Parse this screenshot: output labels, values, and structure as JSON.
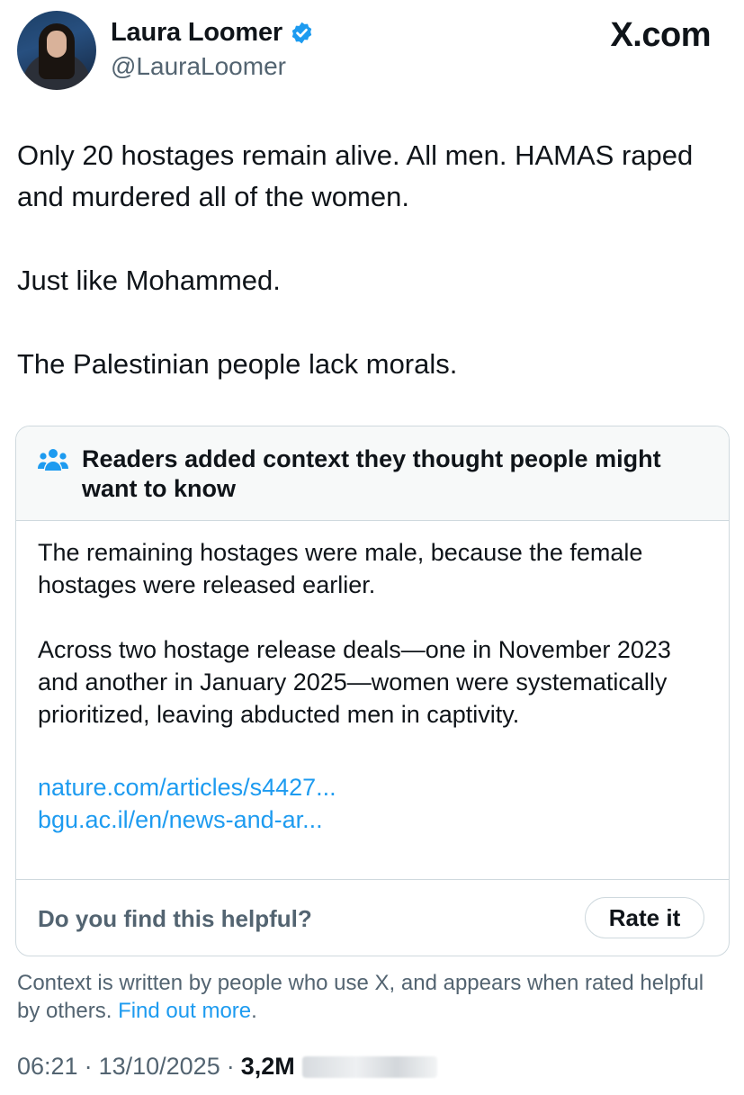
{
  "author": {
    "display_name": "Laura Loomer",
    "handle": "@LauraLoomer",
    "verified_icon": "verified-badge-icon"
  },
  "brand": {
    "logo_text": "X.com",
    "accent": "#1d9bf0"
  },
  "tweet": {
    "lines": [
      "Only 20 hostages remain alive. All men. HAMAS raped and murdered all of the women.",
      "Just like Mohammed.",
      "The Palestinian people lack morals."
    ]
  },
  "community_note": {
    "icon": "people-icon",
    "title": "Readers added context they thought people might want to know",
    "paragraphs": [
      "The remaining hostages were male, because the female hostages were released earlier.",
      "Across two hostage release deals—one in November 2023 and another in January 2025—women were systematically prioritized, leaving abducted men in captivity."
    ],
    "links": [
      "nature.com/articles/s4427...",
      "bgu.ac.il/en/news-and-ar..."
    ],
    "helpful_prompt": "Do you find this helpful?",
    "rate_button": "Rate it"
  },
  "disclaimer": {
    "text": "Context is written by people who use X, and appears when rated helpful by others.",
    "link": "Find out more",
    "end": "."
  },
  "meta": {
    "time": "06:21",
    "date": "13/10/2025",
    "separator": "·",
    "views": "3,2M"
  }
}
